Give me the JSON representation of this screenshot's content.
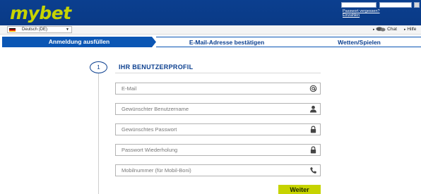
{
  "header": {
    "logo_text": "mybet",
    "forgot_password_link": "Passwort vergessen?",
    "deposit_link": "Einzahlen"
  },
  "subbar": {
    "language": "Deutsch (DE)",
    "chat_label": "Chat",
    "help_label": "Hilfe"
  },
  "steps": [
    {
      "label": "Anmeldung ausfüllen",
      "active": true
    },
    {
      "label": "E-Mail-Adresse bestätigen",
      "active": false
    },
    {
      "label": "Wetten/Spielen",
      "active": false
    }
  ],
  "profile": {
    "step_number": "1",
    "title": "IHR BENUTZERPROFIL",
    "fields": [
      {
        "placeholder": "E-Mail",
        "icon": "at-icon"
      },
      {
        "placeholder": "Gewünschter Benutzername",
        "icon": "user-icon"
      },
      {
        "placeholder": "Gewünschtes Passwort",
        "icon": "lock-icon"
      },
      {
        "placeholder": "Passwort Wiederholung",
        "icon": "lock-icon"
      },
      {
        "placeholder": "Mobilnummer (für Mobil-Boni)",
        "icon": "phone-icon"
      }
    ],
    "next_button": "Weiter"
  },
  "colors": {
    "header_blue": "#0b3f8f",
    "step_active": "#0b56b4",
    "accent_lime": "#c6d300"
  }
}
